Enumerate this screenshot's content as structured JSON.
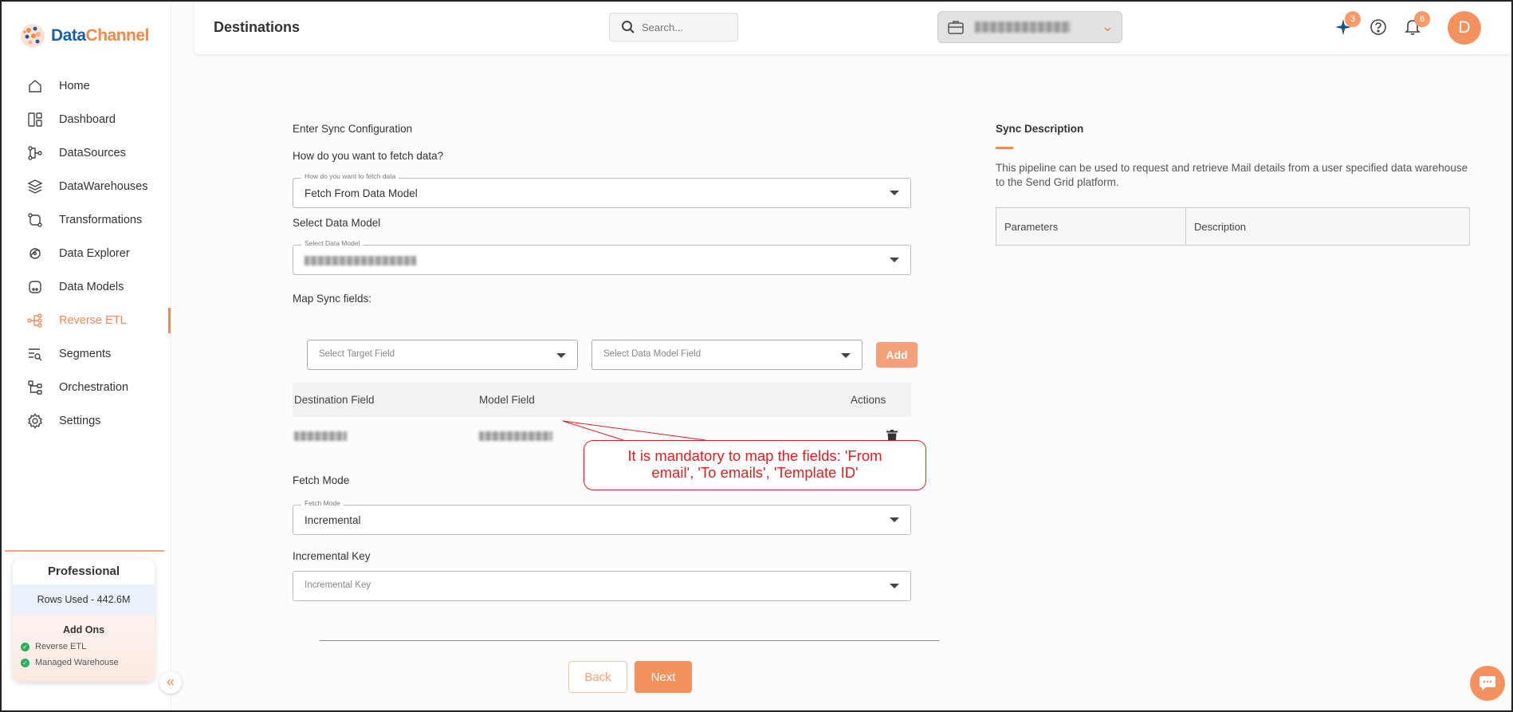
{
  "brand": {
    "name_part1": "Data",
    "name_part2": "Channel"
  },
  "sidebar": {
    "items": [
      {
        "label": "Home",
        "icon": "home-icon"
      },
      {
        "label": "Dashboard",
        "icon": "dashboard-icon"
      },
      {
        "label": "DataSources",
        "icon": "datasources-icon"
      },
      {
        "label": "DataWarehouses",
        "icon": "layers-icon"
      },
      {
        "label": "Transformations",
        "icon": "transform-icon"
      },
      {
        "label": "Data Explorer",
        "icon": "explorer-icon"
      },
      {
        "label": "Data Models",
        "icon": "data-models-icon"
      },
      {
        "label": "Reverse ETL",
        "icon": "reverse-etl-icon",
        "active": true
      },
      {
        "label": "Segments",
        "icon": "segments-icon"
      },
      {
        "label": "Orchestration",
        "icon": "orchestration-icon"
      },
      {
        "label": "Settings",
        "icon": "gear-icon"
      }
    ],
    "plan": {
      "title": "Professional",
      "rows_used": "Rows Used - 442.6M",
      "addons_title": "Add Ons",
      "addons": [
        "Reverse ETL",
        "Managed Warehouse"
      ]
    }
  },
  "header": {
    "title": "Destinations",
    "search_placeholder": "Search...",
    "ai_badge": "3",
    "notifications_badge": "6",
    "avatar_initial": "D"
  },
  "form": {
    "section_title": "Enter Sync Configuration",
    "fetch_question": "How do you want to fetch data?",
    "fetch_legend": "How do you want to fetch data",
    "fetch_value": "Fetch From Data Model",
    "data_model_label": "Select Data Model",
    "data_model_legend": "Select Data Model",
    "map_label": "Map Sync fields:",
    "target_field_placeholder": "Select Target Field",
    "model_field_placeholder": "Select Data Model Field",
    "add_label": "Add",
    "table_headers": {
      "destination": "Destination Field",
      "model": "Model Field",
      "actions": "Actions"
    },
    "fetch_mode_label": "Fetch Mode",
    "fetch_mode_legend": "Fetch Mode",
    "fetch_mode_value": "Incremental",
    "incremental_key_label": "Incremental Key",
    "incremental_key_placeholder": "Incremental Key",
    "back_label": "Back",
    "next_label": "Next"
  },
  "callout": {
    "line1": "It is mandatory to map the fields: 'From",
    "line2": "email', 'To emails', 'Template ID'",
    "color": "#e02020"
  },
  "description": {
    "title": "Sync Description",
    "text": "This pipeline can be used to request and retrieve Mail details from a user specified data warehouse to the Send Grid platform.",
    "columns": [
      "Parameters",
      "Description"
    ]
  },
  "colors": {
    "accent": "#f4925f",
    "brand_blue": "#1c5fa8"
  }
}
